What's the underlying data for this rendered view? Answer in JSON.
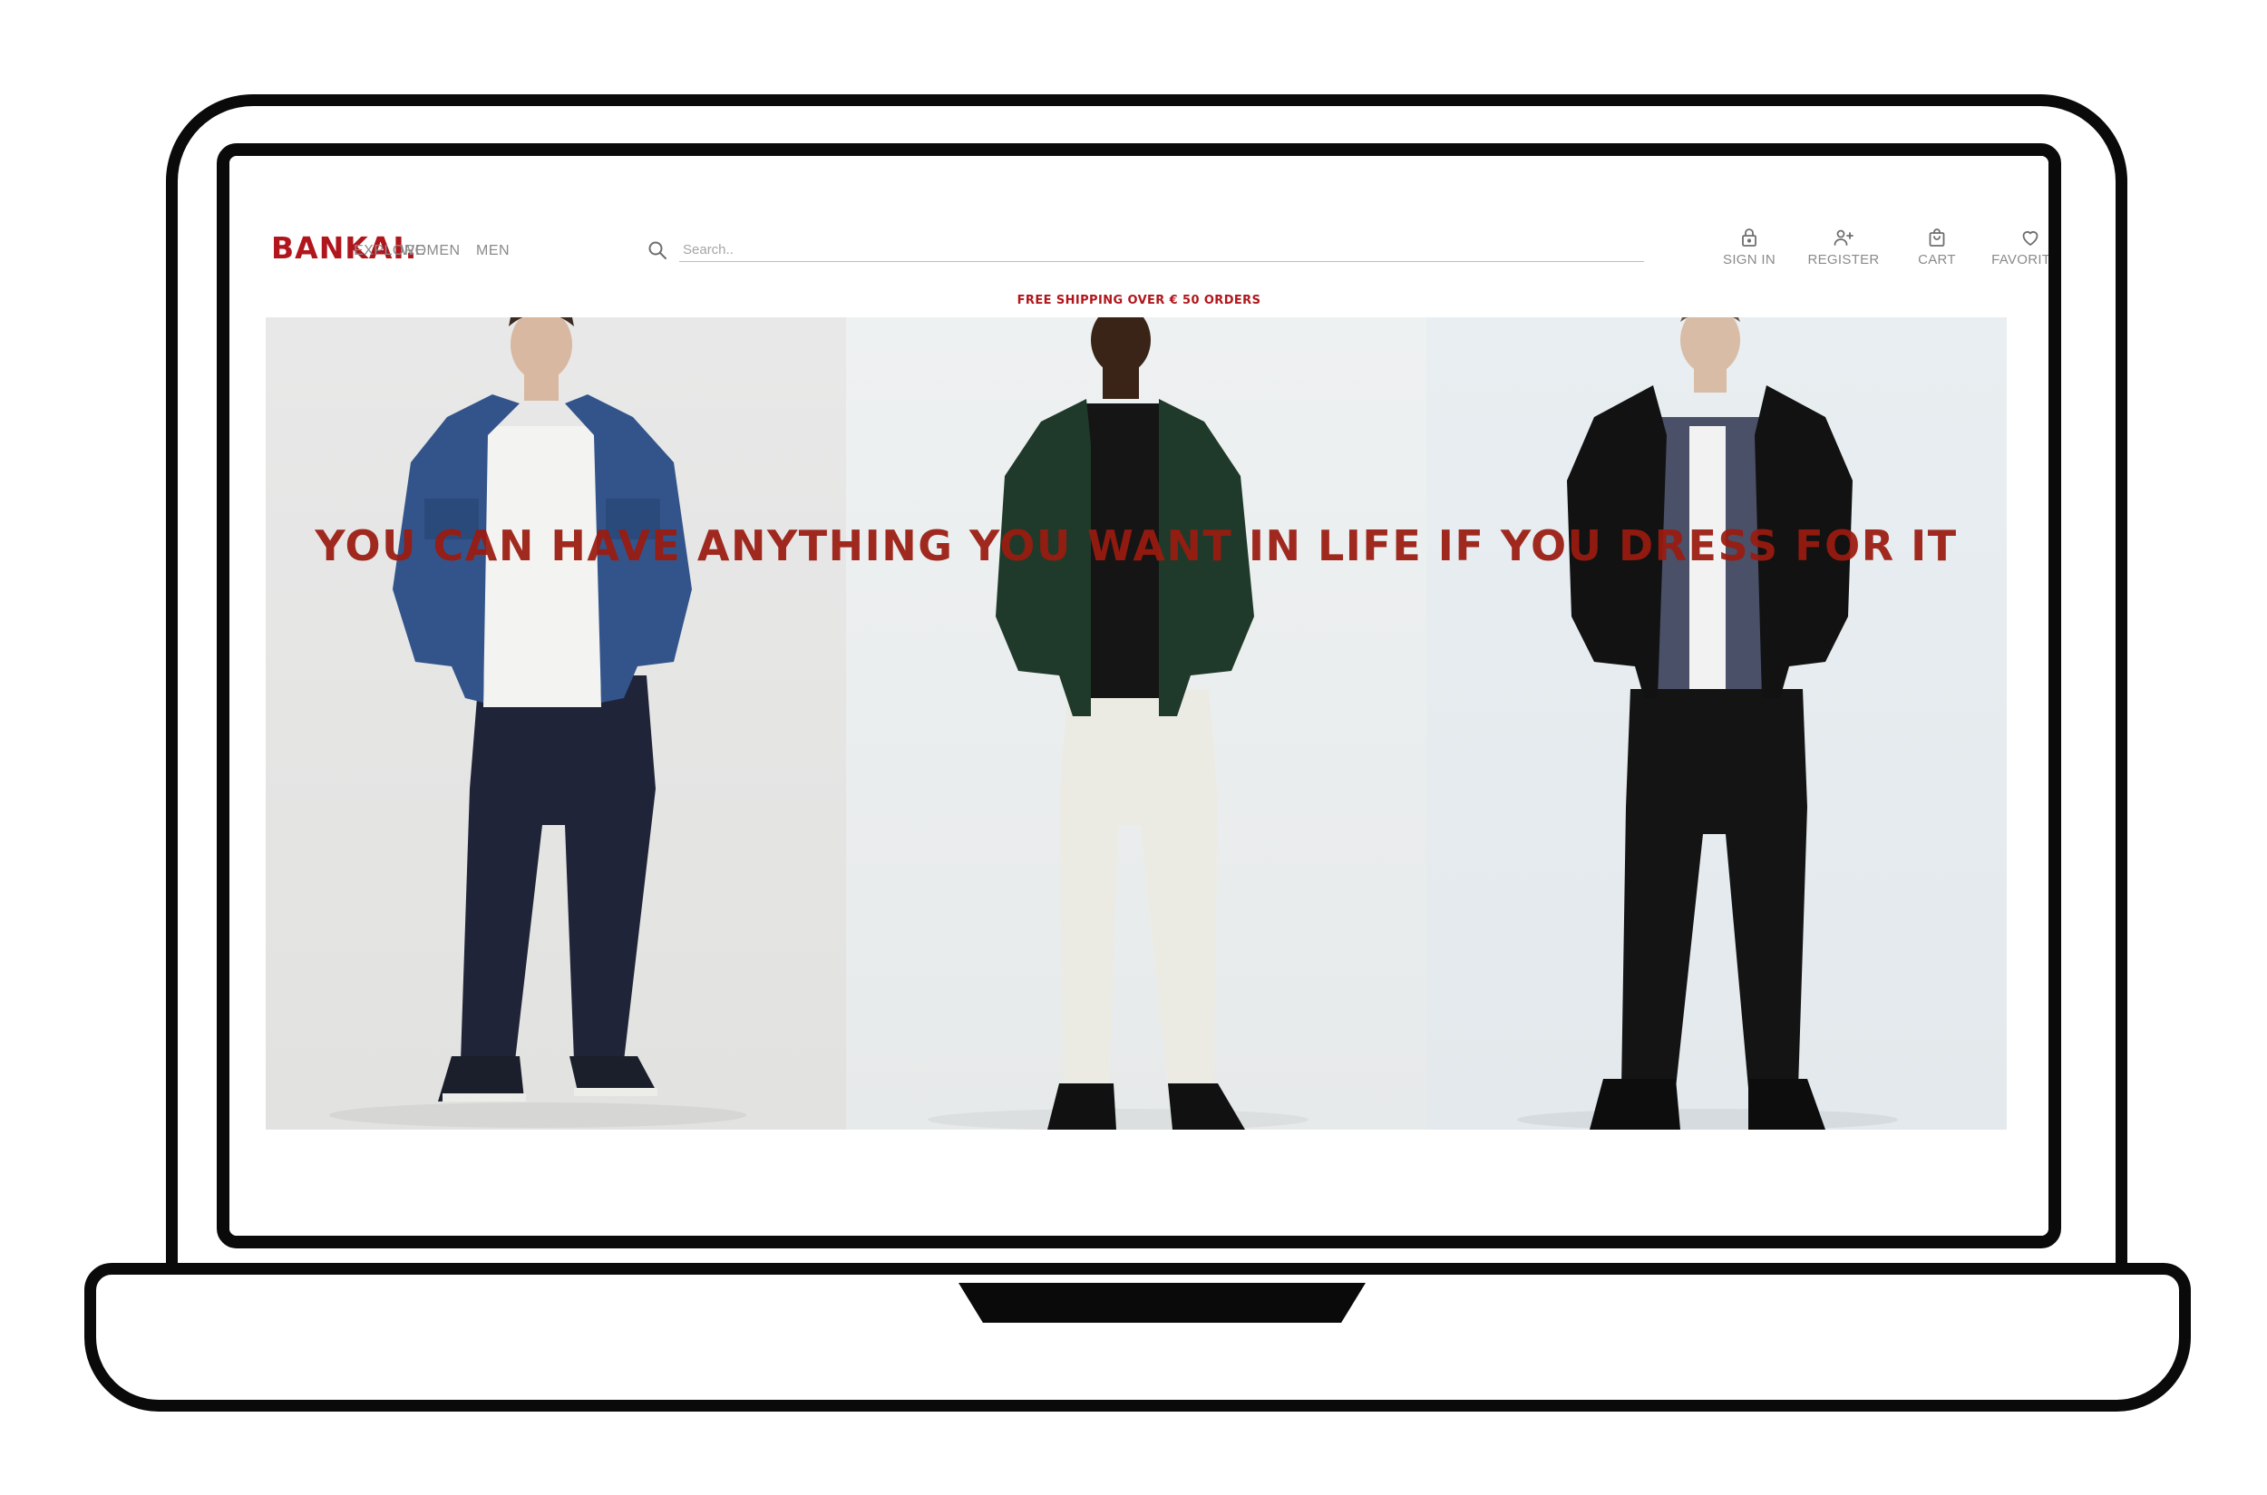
{
  "brand": {
    "name": "BANKAI."
  },
  "nav": {
    "items": [
      {
        "label": "EXPLORE"
      },
      {
        "label": "WOMEN"
      },
      {
        "label": "MEN"
      }
    ]
  },
  "search": {
    "placeholder": "Search.."
  },
  "actions": [
    {
      "label": "SIGN IN",
      "icon": "lock-icon"
    },
    {
      "label": "REGISTER",
      "icon": "user-plus-icon"
    },
    {
      "label": "CART",
      "icon": "shopping-bag-icon"
    },
    {
      "label": "FAVORITES",
      "icon": "heart-icon"
    }
  ],
  "promo": {
    "text": "FREE SHIPPING OVER € 50 ORDERS"
  },
  "hero": {
    "headline": "YOU CAN HAVE ANYTHING YOU WANT IN LIFE IF YOU DRESS FOR IT",
    "panels": [
      {
        "outfit": "denim jacket, navy trousers, sneakers"
      },
      {
        "outfit": "green jacket, black tee, white jeans"
      },
      {
        "outfit": "black puffer jacket, check shirt, black trousers"
      }
    ]
  },
  "colors": {
    "brand": "#b1161c",
    "headline": "#9b1b10",
    "frame": "#0a0a0a",
    "muted_text": "#8a8a8a"
  }
}
